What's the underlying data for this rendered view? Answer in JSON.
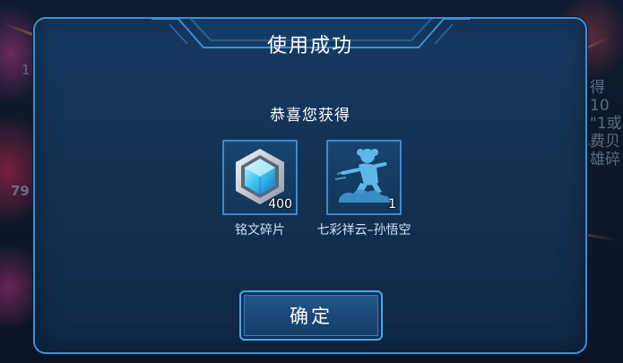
{
  "dialog": {
    "title": "使用成功",
    "subtitle": "恭喜您获得",
    "confirm_label": "确定",
    "rewards": [
      {
        "name": "铭文碎片",
        "quantity": "400",
        "icon": "hexagon-crystal-icon"
      },
      {
        "name": "七彩祥云–孙悟空",
        "quantity": "1",
        "icon": "hero-skin-silhouette-icon"
      }
    ]
  },
  "background": {
    "right_text_lines": [
      "得10",
      "\"1或",
      "费贝",
      "雄碎"
    ],
    "left_numbers": [
      "1",
      "79"
    ]
  },
  "colors": {
    "dialog_border": "#3c8fd6",
    "dialog_bg": "#133152",
    "text": "#ffffff",
    "label_text": "#cfe2f6"
  }
}
